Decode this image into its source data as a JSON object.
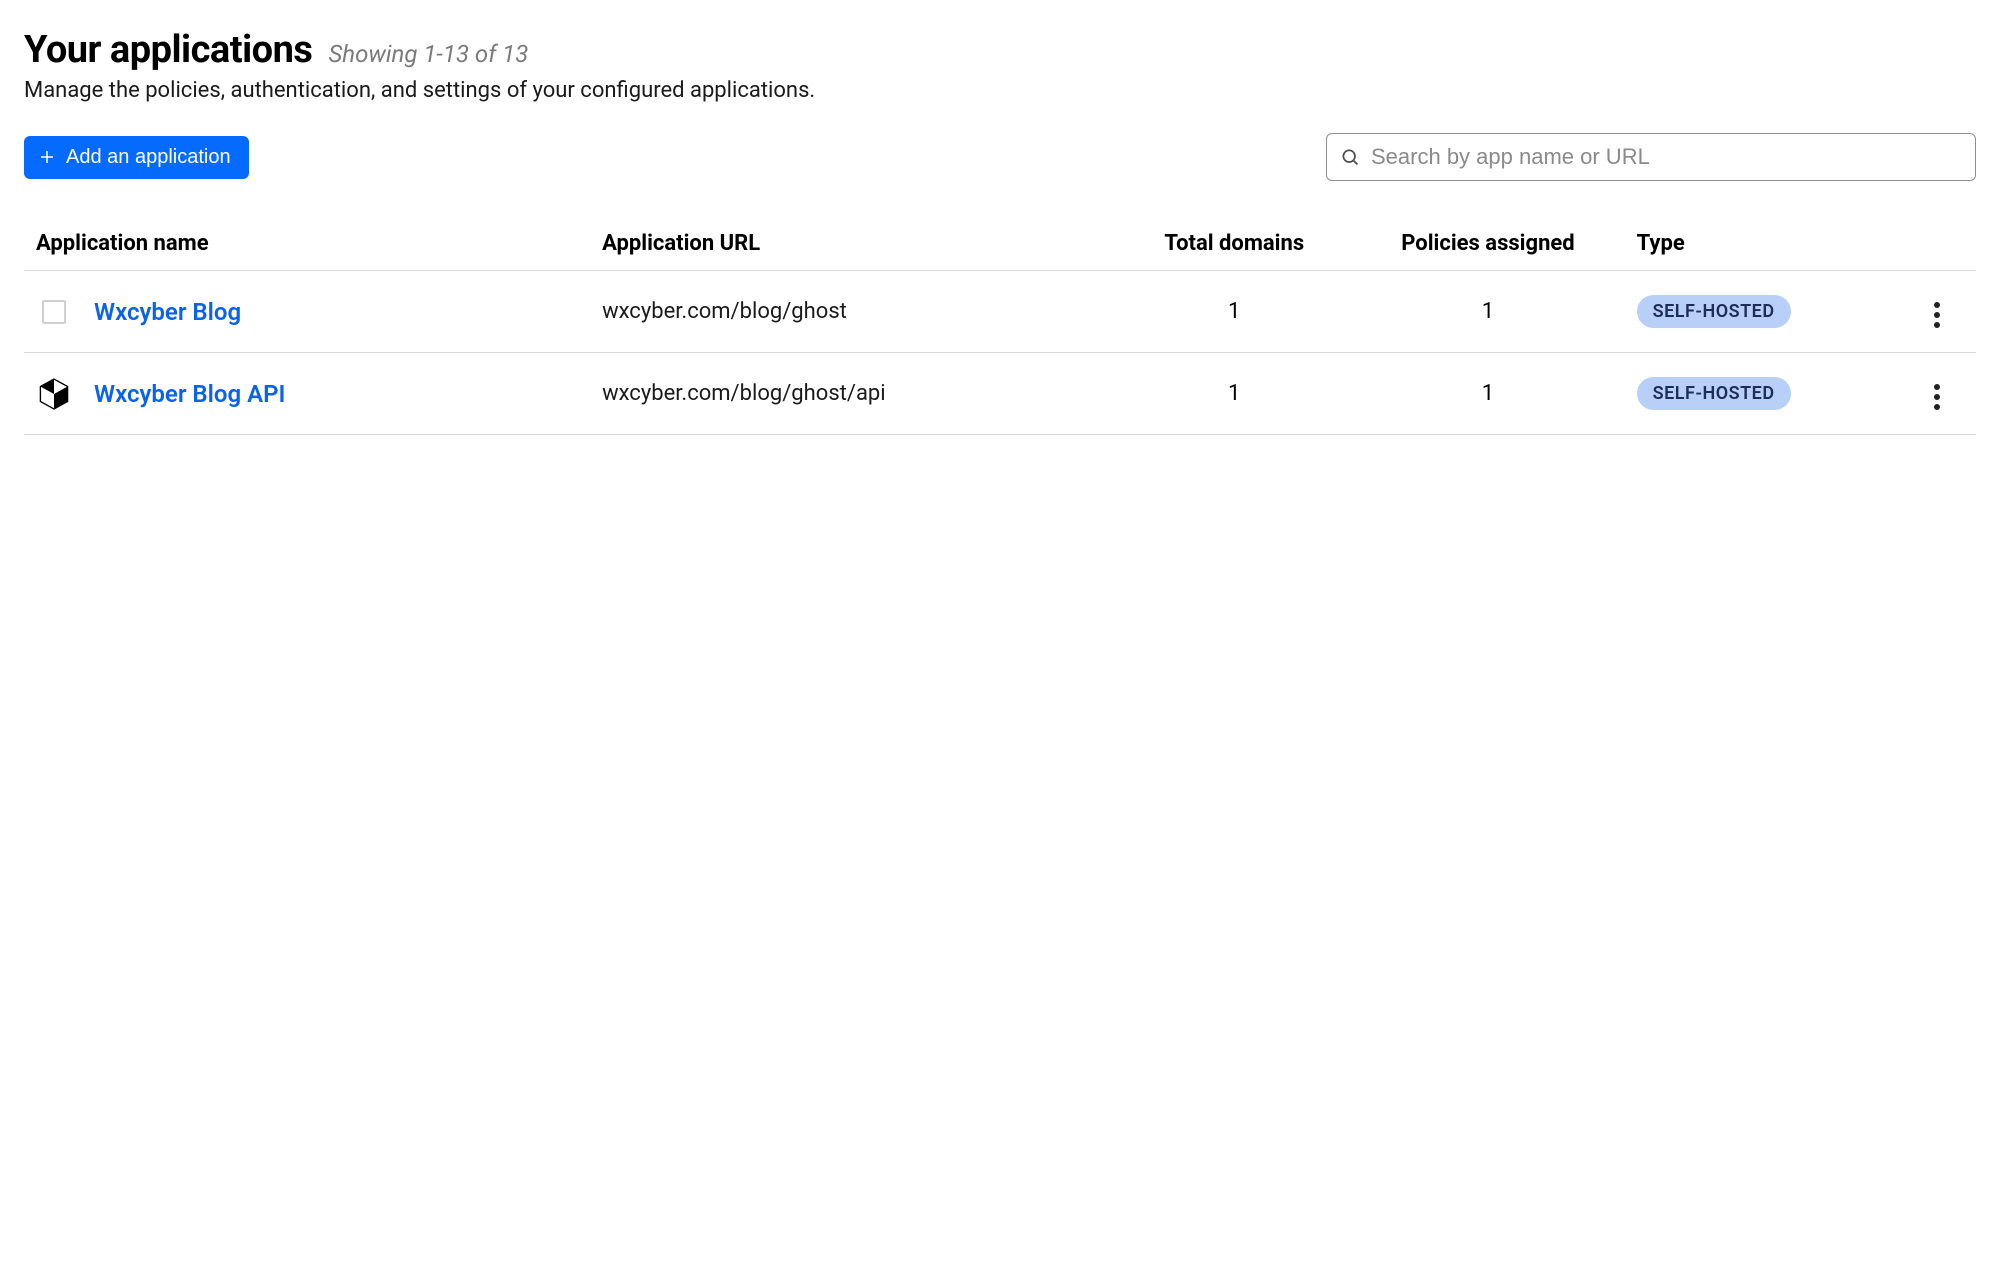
{
  "header": {
    "title": "Your applications",
    "count_text": "Showing 1-13 of 13",
    "subtitle": "Manage the policies, authentication, and settings of your configured applications."
  },
  "controls": {
    "add_button_label": "Add an application",
    "search_placeholder": "Search by app name or URL"
  },
  "table": {
    "columns": {
      "name": "Application name",
      "url": "Application URL",
      "domains": "Total domains",
      "policies": "Policies assigned",
      "type": "Type"
    },
    "rows": [
      {
        "icon": "empty",
        "name": "Wxcyber Blog",
        "url": "wxcyber.com/blog/ghost",
        "domains": "1",
        "policies": "1",
        "type_badge": "SELF-HOSTED"
      },
      {
        "icon": "hex",
        "name": "Wxcyber Blog API",
        "url": "wxcyber.com/blog/ghost/api",
        "domains": "1",
        "policies": "1",
        "type_badge": "SELF-HOSTED"
      }
    ]
  }
}
